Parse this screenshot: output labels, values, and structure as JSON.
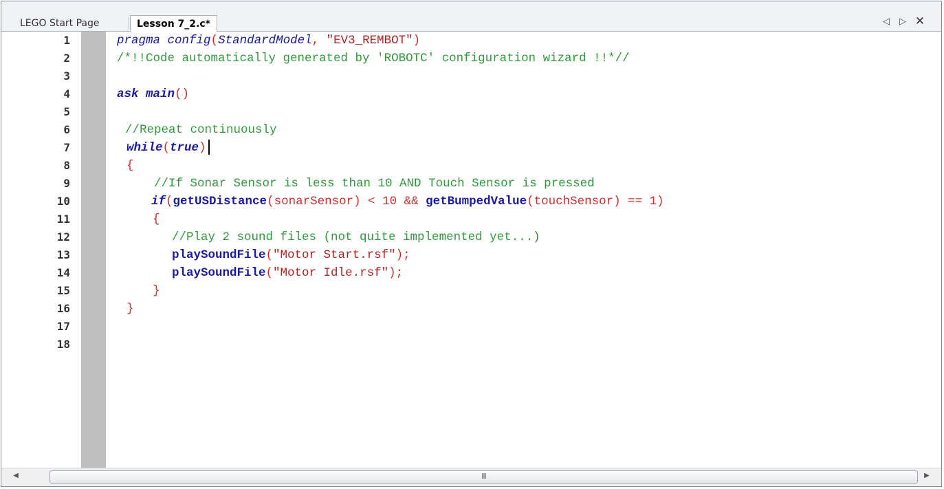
{
  "tabs": [
    {
      "label": "LEGO Start Page"
    },
    {
      "label": "Lesson 7_2.c*"
    }
  ],
  "tab_controls": {
    "left": "◁",
    "right": "▷",
    "close": "✕"
  },
  "editor": {
    "line_numbers": [
      "1",
      "2",
      "3",
      "4",
      "5",
      "6",
      "7",
      "8",
      "9",
      "10",
      "11",
      "12",
      "13",
      "14",
      "15",
      "16",
      "17",
      "18"
    ],
    "line1": {
      "kw": "pragma",
      "fn": "config",
      "open": "(",
      "arg": "StandardModel",
      "comma": ",",
      "str": "\"EV3_REMBOT\"",
      "close": ")"
    },
    "line2": {
      "comment": "/*!!Code automatically generated by 'ROBOTC' configuration wizard !!*//"
    },
    "line4": {
      "kw": "ask",
      "fn": "main",
      "parens": "()"
    },
    "line6": {
      "comment": "//Repeat continuously"
    },
    "line7": {
      "kw": "while",
      "open": "(",
      "val": "true",
      "close": ")"
    },
    "line8": {
      "brace": "{"
    },
    "line9": {
      "comment": "//If Sonar Sensor is less than 10 AND Touch Sensor is pressed"
    },
    "line10": {
      "kw": "if",
      "open": "(",
      "fn1": "getUSDistance",
      "args1": "(sonarSensor) < 10 && ",
      "fn2": "getBumpedValue",
      "args2": "(touchSensor) == 1)"
    },
    "line11": {
      "brace": "{"
    },
    "line12": {
      "comment": "//Play 2 sound files (not quite implemented yet...)"
    },
    "line13": {
      "fn": "playSoundFile",
      "open": "(",
      "str": "\"Motor Start.rsf\"",
      "close": ");"
    },
    "line14": {
      "fn": "playSoundFile",
      "open": "(",
      "str": "\"Motor Idle.rsf\"",
      "close": ");"
    },
    "line15": {
      "brace": "}"
    },
    "line16": {
      "brace": "}"
    }
  },
  "scrollbar": {
    "left_arrow": "◀",
    "right_arrow": "▶",
    "grip": "III"
  }
}
